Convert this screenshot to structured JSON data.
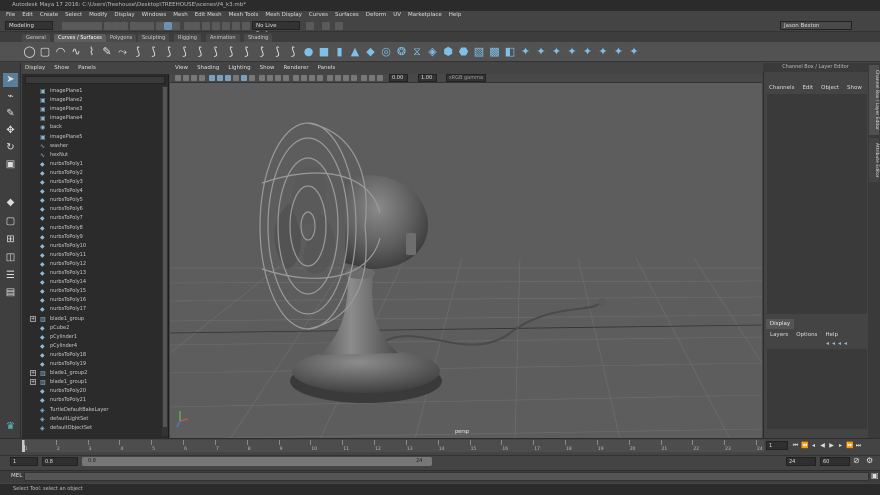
{
  "title": "Autodesk Maya 17 2016: C:\\Users\\Treehouse\\Desktop\\TREEHOUSE\\scenes\\f4_k3.mb*",
  "menus": [
    "File",
    "Edit",
    "Create",
    "Select",
    "Modify",
    "Display",
    "Windows",
    "Mesh",
    "Edit Mesh",
    "Mesh Tools",
    "Mesh Display",
    "Curves",
    "Surfaces",
    "Deform",
    "UV",
    "Marketplace",
    "Help"
  ],
  "status": {
    "mode": "Modeling",
    "live_surface": "No Live Surface",
    "user": "Jason Beston"
  },
  "shelf_tabs": [
    "General",
    "Curves / Surfaces",
    "Polygons",
    "Sculpting",
    "Rigging",
    "Animation",
    "Shading"
  ],
  "shelf_active": 1,
  "shelf_icons": [
    "circle-icon",
    "square-icon",
    "arc-icon",
    "cv-curve-icon",
    "ep-curve-icon",
    "pencil-curve-icon",
    "bezier-icon",
    "curve-tool-icon",
    "curve-tool-icon",
    "curve-tool-icon",
    "curve-tool-icon",
    "curve-tool-icon",
    "curve-tool-icon",
    "curve-tool-icon",
    "curve-tool-icon",
    "curve-tool-icon",
    "curve-tool-icon",
    "curve-tool-icon",
    "sphere-icon",
    "cube-icon",
    "cylinder-icon",
    "cone-icon",
    "plane-icon",
    "torus-icon",
    "revolve-icon",
    "loft-icon",
    "planar-icon",
    "extrude-icon",
    "birail-icon",
    "boundary-icon",
    "square-surface-icon",
    "bevel-icon",
    "surface-tool-icon",
    "surface-tool-icon",
    "surface-tool-icon",
    "surface-tool-icon",
    "surface-tool-icon",
    "surface-tool-icon",
    "surface-tool-icon",
    "surface-tool-icon"
  ],
  "outliner": {
    "menu": [
      "Display",
      "Show",
      "Panels"
    ],
    "items": [
      {
        "label": "imagePlane1",
        "type": "image",
        "expandable": false
      },
      {
        "label": "imagePlane2",
        "type": "image",
        "expandable": false
      },
      {
        "label": "imagePlane3",
        "type": "image",
        "expandable": false
      },
      {
        "label": "imagePlane4",
        "type": "image",
        "expandable": false
      },
      {
        "label": "back",
        "type": "camera",
        "expandable": false
      },
      {
        "label": "imagePlane5",
        "type": "image",
        "expandable": false
      },
      {
        "label": "washer",
        "type": "curve",
        "expandable": false
      },
      {
        "label": "hexNut",
        "type": "curve",
        "expandable": false
      },
      {
        "label": "nurbsToPoly1",
        "type": "mesh",
        "expandable": false
      },
      {
        "label": "nurbsToPoly2",
        "type": "mesh",
        "expandable": false
      },
      {
        "label": "nurbsToPoly3",
        "type": "mesh",
        "expandable": false
      },
      {
        "label": "nurbsToPoly4",
        "type": "mesh",
        "expandable": false
      },
      {
        "label": "nurbsToPoly5",
        "type": "mesh",
        "expandable": false
      },
      {
        "label": "nurbsToPoly6",
        "type": "mesh",
        "expandable": false
      },
      {
        "label": "nurbsToPoly7",
        "type": "mesh",
        "expandable": false
      },
      {
        "label": "nurbsToPoly8",
        "type": "mesh",
        "expandable": false
      },
      {
        "label": "nurbsToPoly9",
        "type": "mesh",
        "expandable": false
      },
      {
        "label": "nurbsToPoly10",
        "type": "mesh",
        "expandable": false
      },
      {
        "label": "nurbsToPoly11",
        "type": "mesh",
        "expandable": false
      },
      {
        "label": "nurbsToPoly12",
        "type": "mesh",
        "expandable": false
      },
      {
        "label": "nurbsToPoly13",
        "type": "mesh",
        "expandable": false
      },
      {
        "label": "nurbsToPoly14",
        "type": "mesh",
        "expandable": false
      },
      {
        "label": "nurbsToPoly15",
        "type": "mesh",
        "expandable": false
      },
      {
        "label": "nurbsToPoly16",
        "type": "mesh",
        "expandable": false
      },
      {
        "label": "nurbsToPoly17",
        "type": "mesh",
        "expandable": false
      },
      {
        "label": "blade1_group",
        "type": "group",
        "expandable": true
      },
      {
        "label": "pCube2",
        "type": "mesh",
        "expandable": false
      },
      {
        "label": "pCylinder1",
        "type": "mesh",
        "expandable": false
      },
      {
        "label": "pCylinder4",
        "type": "mesh",
        "expandable": false
      },
      {
        "label": "nurbsToPoly18",
        "type": "mesh",
        "expandable": false
      },
      {
        "label": "nurbsToPoly19",
        "type": "mesh",
        "expandable": false
      },
      {
        "label": "blade1_group2",
        "type": "group",
        "expandable": true
      },
      {
        "label": "blade1_group1",
        "type": "group",
        "expandable": true
      },
      {
        "label": "nurbsToPoly20",
        "type": "mesh",
        "expandable": false
      },
      {
        "label": "nurbsToPoly21",
        "type": "mesh",
        "expandable": false
      },
      {
        "label": "TurtleDefaultBakeLayer",
        "type": "set",
        "expandable": false
      },
      {
        "label": "defaultLightSet",
        "type": "set",
        "expandable": false
      },
      {
        "label": "defaultObjectSet",
        "type": "set",
        "expandable": false
      }
    ]
  },
  "viewport": {
    "menu": [
      "View",
      "Shading",
      "Lighting",
      "Show",
      "Renderer",
      "Panels"
    ],
    "field_a": "0.00",
    "field_b": "1.00",
    "colorspace": "sRGB gamma",
    "camera": "persp"
  },
  "channel_box": {
    "title": "Channel Box / Layer Editor",
    "menu": [
      "Channels",
      "Edit",
      "Object",
      "Show"
    ],
    "layer_tab": "Display",
    "layer_menu": [
      "Layers",
      "Options",
      "Help"
    ]
  },
  "side_tabs": [
    "Channel Box / Layer Editor",
    "Attribute Editor"
  ],
  "timeline": {
    "ticks": [
      "1",
      "2",
      "3",
      "4",
      "5",
      "6",
      "7",
      "8",
      "9",
      "10",
      "11",
      "12",
      "13",
      "14",
      "15",
      "16",
      "17",
      "18",
      "19",
      "20",
      "21",
      "22",
      "23",
      "24"
    ],
    "current": "1"
  },
  "range": {
    "start": "1",
    "inner_start": "0.8",
    "slider_start": "0.8",
    "slider_end": "24",
    "end": "24",
    "anim_end": "60"
  },
  "mel_label": "MEL",
  "help_text": "Select Tool: select an object"
}
